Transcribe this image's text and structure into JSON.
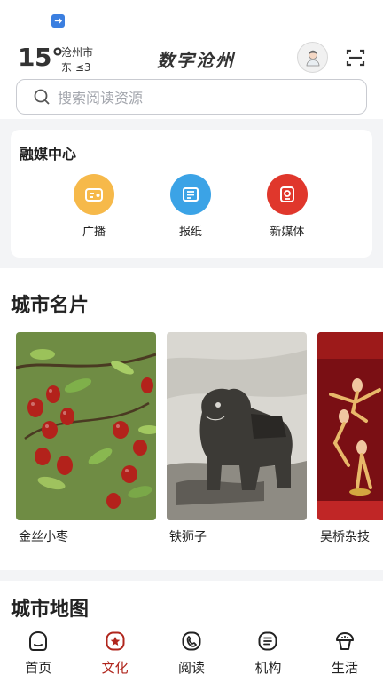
{
  "header": {
    "temperature": "15°",
    "city": "沧州市",
    "wind": "东 ≤3",
    "app_title": "数字沧州",
    "search_placeholder": "搜索阅读资源"
  },
  "media_center": {
    "title": "融媒中心",
    "items": [
      {
        "label": "广播",
        "icon": "radio-icon",
        "color": "#f6b94a"
      },
      {
        "label": "报纸",
        "icon": "newspaper-icon",
        "color": "#3ba3e6"
      },
      {
        "label": "新媒体",
        "icon": "new-media-icon",
        "color": "#e0372c"
      }
    ]
  },
  "city_cards": {
    "title": "城市名片",
    "items": [
      {
        "label": "金丝小枣"
      },
      {
        "label": "铁狮子"
      },
      {
        "label": "吴桥杂技"
      }
    ]
  },
  "city_map": {
    "title": "城市地图"
  },
  "bottom_nav": {
    "active_color": "#b0261d",
    "items": [
      {
        "label": "首页",
        "icon": "home-icon"
      },
      {
        "label": "文化",
        "icon": "culture-icon"
      },
      {
        "label": "阅读",
        "icon": "reading-icon"
      },
      {
        "label": "机构",
        "icon": "institution-icon"
      },
      {
        "label": "生活",
        "icon": "life-icon"
      }
    ]
  }
}
